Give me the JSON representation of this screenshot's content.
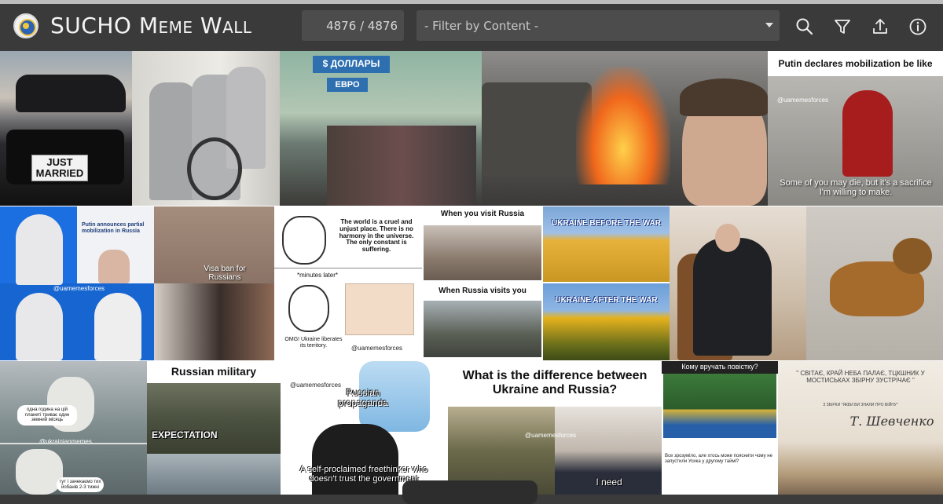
{
  "header": {
    "title": "SUCHO Meme Wall",
    "count": "4876 / 4876",
    "filter_label": "- Filter by Content -"
  },
  "icons": [
    "logo",
    "search-icon",
    "filter-icon",
    "upload-icon",
    "info-icon"
  ],
  "colors": {
    "header_bg": "#3a3a3a",
    "field_bg": "#4c4c4c",
    "ukraine_blue": "#2c63b3",
    "ukraine_yellow": "#f3c63c"
  },
  "memes": {
    "just_married": "JUST MARRIED",
    "dollars_sign": "$ ДОЛЛАРЫ",
    "euro_sign": "ЕВРО",
    "mobilization_title": "Putin declares mobilization be like",
    "mobilization_handle": "@uamemesforces",
    "mobilization_caption": "Some of you may die, but it's a sacrifice I'm willing to make.",
    "dw_headline": "Putin announces partial mobilization in Russia",
    "dw_handle": "@uamemesforces",
    "visa_ban": "Visa ban for Russians",
    "wojak_top": "The world is a cruel and unjust place. There is no harmony in the universe. The only constant is suffering.",
    "minutes_later": "*minutes later*",
    "wojak_bottom": "OMG! Ukraine liberates its territory.",
    "wojak_handle": "@uamemesforces",
    "visit_russia": "When you visit Russia",
    "russia_visits": "When Russia visits you",
    "before_war": "UKRAINE BEFORE THE WAR",
    "after_war": "UKRAINE AFTER THE WAR",
    "interstellar_top": "одна година на цій планеті триває один земний місяць",
    "interstellar_handle": "@ukrainianmemes",
    "interstellar_bottom": "тут і зачекаємо тих йобанів 2-3 тижні",
    "russian_military": "Russian military",
    "expectation": "EXPECTATION",
    "propaganda_handle": "@uamemesforces",
    "propaganda": "Russian propaganda",
    "freethinker": "A self-proclaimed freethinker who doesn't trust the government",
    "difference": "What is the difference between Ukraine and Russia?",
    "difference_handle": "@uamemesforces",
    "i_need": "I need",
    "povistka": "Кому вручать повістку?",
    "fb_post": "Все зрозуміло, але хтось може пояснити чому не запустили Усика у другому таймі?",
    "shevchenko_quote": "\" СВІТАЄ, КРАЙ НЕБА ПАЛАЄ, ТЦКШНИК У МОСТИСЬКАХ ЗБІРНУ ЗУСТРІЧАЄ \"",
    "shevchenko_sub": "З ЗБІРКИ \"ЯКБИ ВИ ЗНАЛИ ПРО ВІЙНУ\"",
    "shevchenko_sign": "Т. Шевченко"
  }
}
